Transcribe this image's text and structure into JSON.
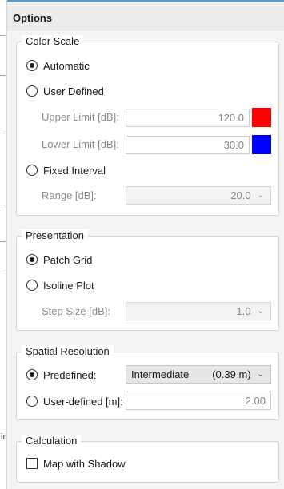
{
  "panel": {
    "title": "Options"
  },
  "colors": {
    "upper_swatch": "#ff0000",
    "lower_swatch": "#0000ff",
    "accent_strip": "#5b9bd5"
  },
  "color_scale": {
    "title": "Color Scale",
    "automatic": "Automatic",
    "user_defined": "User Defined",
    "upper_limit_label": "Upper Limit [dB]:",
    "upper_limit_value": "120.0",
    "lower_limit_label": "Lower Limit [dB]:",
    "lower_limit_value": "30.0",
    "fixed_interval": "Fixed Interval",
    "range_label": "Range [dB]:",
    "range_value": "20.0",
    "selected": "automatic"
  },
  "presentation": {
    "title": "Presentation",
    "patch_grid": "Patch Grid",
    "isoline_plot": "Isoline Plot",
    "step_size_label": "Step Size [dB]:",
    "step_size_value": "1.0",
    "selected": "patch_grid"
  },
  "spatial_resolution": {
    "title": "Spatial Resolution",
    "predefined": "Predefined:",
    "predefined_value": "Intermediate",
    "predefined_detail": "(0.39 m)",
    "user_defined": "User-defined [m]:",
    "user_defined_value": "2.00",
    "selected": "predefined"
  },
  "calculation": {
    "title": "Calculation",
    "map_with_shadow": "Map with Shadow",
    "map_with_shadow_checked": false
  },
  "left_strip": {
    "glyph": "ir"
  }
}
